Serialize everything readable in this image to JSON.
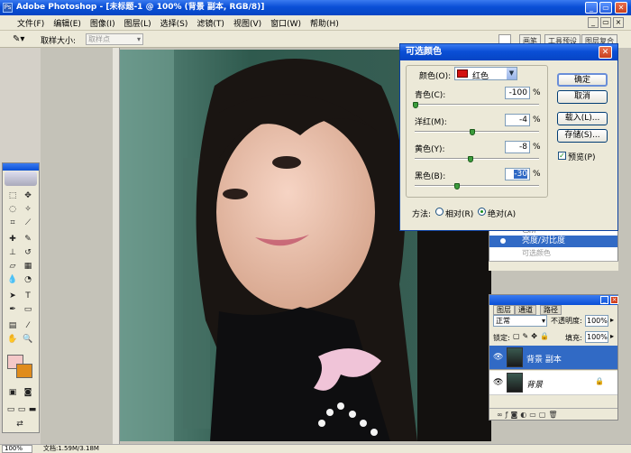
{
  "window": {
    "title": "Adobe Photoshop - [未标题-1 @ 100% (背景 副本, RGB/8)]"
  },
  "menu": [
    "文件(F)",
    "编辑(E)",
    "图像(I)",
    "图层(L)",
    "选择(S)",
    "滤镜(T)",
    "视图(V)",
    "窗口(W)",
    "帮助(H)"
  ],
  "options": {
    "sample_size_label": "取样大小:",
    "sample_value": "取样点"
  },
  "palette_tabs": [
    "画笔",
    "工具预设",
    "图层复合"
  ],
  "dialog": {
    "title": "可选颜色",
    "color_label": "颜色(O):",
    "color_value": "红色",
    "sliders": [
      {
        "label": "青色(C):",
        "value": "-100",
        "pct": "%",
        "position": 0.0
      },
      {
        "label": "洋红(M):",
        "value": "-4",
        "pct": "%",
        "position": 0.48
      },
      {
        "label": "黄色(Y):",
        "value": "-8",
        "pct": "%",
        "position": 0.46
      },
      {
        "label": "黑色(B):",
        "value": "-30",
        "pct": "%",
        "position": 0.35
      }
    ],
    "buttons": {
      "ok": "确定",
      "cancel": "取消",
      "load": "载入(L)...",
      "save": "存储(S)..."
    },
    "preview_label": "预览(P)",
    "preview_checked": true,
    "method_label": "方法:",
    "method_relative": "相对(R)",
    "method_absolute": "绝对(A)",
    "method_selected": "absolute"
  },
  "history": {
    "row1": "色阶",
    "row2": "亮度/对比度",
    "row3": "可选颜色"
  },
  "layers": {
    "tabs": [
      "图层",
      "通道",
      "路径"
    ],
    "blend_mode": "正常",
    "opacity_label": "不透明度:",
    "opacity_value": "100%",
    "lock_label": "锁定:",
    "fill_label": "填充:",
    "fill_value": "100%",
    "items": [
      {
        "name": "背景 副本"
      },
      {
        "name": "背景"
      }
    ]
  },
  "status": {
    "zoom": "100%",
    "doc_info": "文档:1.59M/3.18M"
  }
}
